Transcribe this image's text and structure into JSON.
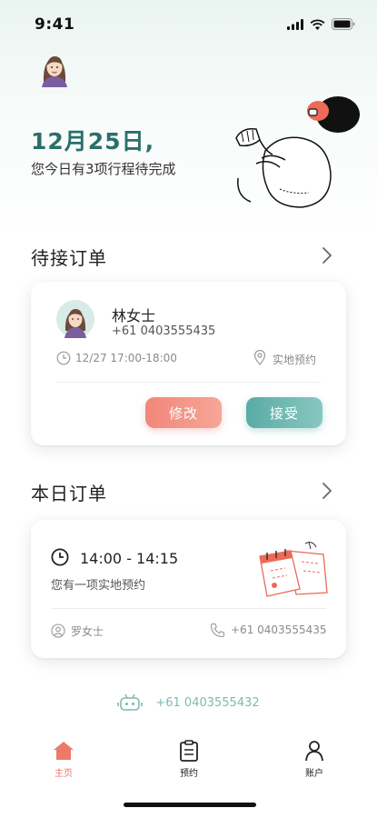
{
  "status_bar": {
    "time": "9:41"
  },
  "greeting": {
    "date": "12月25日,",
    "subtitle": "您今日有3项行程待完成"
  },
  "pending_section": {
    "title": "待接订单",
    "order": {
      "name": "林女士",
      "phone": "+61 0403555435",
      "time": "12/27 17:00-18:00",
      "location": "实地预约",
      "edit_label": "修改",
      "accept_label": "接受"
    }
  },
  "today_section": {
    "title": "本日订单",
    "order": {
      "time_range": "14:00 - 14:15",
      "description": "您有一项实地预约",
      "client": "罗女士",
      "phone": "+61 0403555435"
    }
  },
  "support": {
    "phone": "+61 0403555432"
  },
  "tabbar": {
    "items": [
      {
        "label": "主页",
        "icon": "home-icon",
        "active": true
      },
      {
        "label": "预约",
        "icon": "clipboard-icon",
        "active": false
      },
      {
        "label": "账户",
        "icon": "person-icon",
        "active": false
      }
    ]
  },
  "colors": {
    "teal": "#2a6f6a",
    "coral": "#ec7a6a",
    "accept": "#5aaca5",
    "edit": "#f0877a"
  }
}
